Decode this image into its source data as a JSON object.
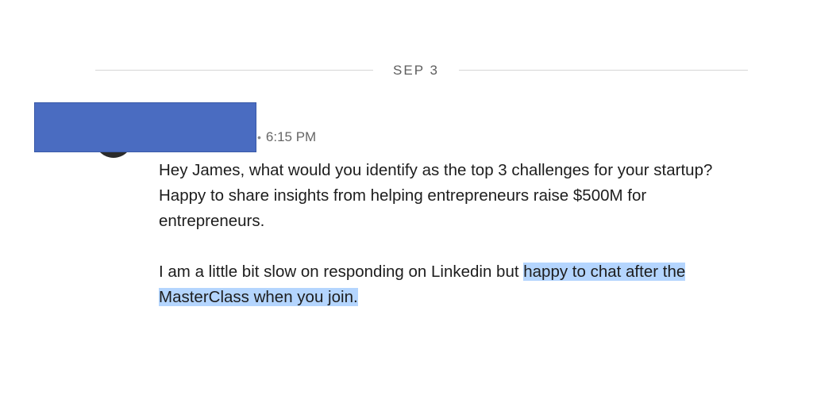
{
  "divider": {
    "date": "SEP 3"
  },
  "message": {
    "time_separator": "•",
    "time": "6:15 PM",
    "line1": "Hey James, what would you identify as the top 3 challenges for your startup?",
    "line2": "Happy to share insights from helping entrepreneurs raise $500M for entrepreneurs.",
    "line3_plain": "I am a little bit slow on responding on Linkedin but ",
    "line3_selected": "happy to chat after the MasterClass when you join."
  },
  "colors": {
    "redaction": "#4a6cc1",
    "selection": "#b4d5fe",
    "divider": "#d6d6d6"
  }
}
